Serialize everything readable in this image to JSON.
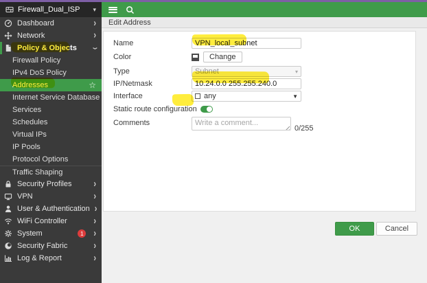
{
  "sidebar": {
    "vdom": "Firewall_Dual_ISP",
    "top": [
      "Dashboard",
      "Network",
      "Policy & Objects"
    ],
    "top_icons": [
      "gauge-icon",
      "network-arrows-icon",
      "document-icon"
    ],
    "sub": [
      "Firewall Policy",
      "IPv4 DoS Policy",
      "Addresses",
      "Internet Service Database",
      "Services",
      "Schedules",
      "Virtual IPs",
      "IP Pools",
      "Protocol Options",
      "Traffic Shaping"
    ],
    "bottom": [
      "Security Profiles",
      "VPN",
      "User & Authentication",
      "WiFi Controller",
      "System",
      "Security Fabric",
      "Log & Report"
    ],
    "bottom_icons": [
      "lock-icon",
      "monitor-icon",
      "user-icon",
      "wifi-icon",
      "gear-icon",
      "fabric-icon",
      "bar-chart-icon"
    ],
    "system_badge": "1",
    "favorite_icon": "star-outline-icon"
  },
  "topbar": {
    "icons": [
      "menu-icon",
      "search-icon"
    ]
  },
  "breadcrumb": "Edit Address",
  "form": {
    "name_label": "Name",
    "name_value": "VPN_local_subnet",
    "color_label": "Color",
    "color_change_label": "Change",
    "type_label": "Type",
    "type_value": "Subnet",
    "ip_label": "IP/Netmask",
    "ip_value": "10.24.0.0 255.255.240.0",
    "interface_label": "Interface",
    "interface_value": "any",
    "static_route_label": "Static route configuration",
    "static_route_enabled": true,
    "comments_label": "Comments",
    "comments_placeholder": "Write a comment...",
    "comments_counter": "0/255"
  },
  "actions": {
    "ok_label": "OK",
    "cancel_label": "Cancel"
  },
  "colors": {
    "accent_green": "#3f9b4a",
    "purple_strip": "#7e5fa5",
    "sidebar_bg": "#3a3a3a",
    "sidebar_header_bg": "#262626",
    "badge_red": "#dd3c3c",
    "highlight_yellow": "#ffe912"
  }
}
